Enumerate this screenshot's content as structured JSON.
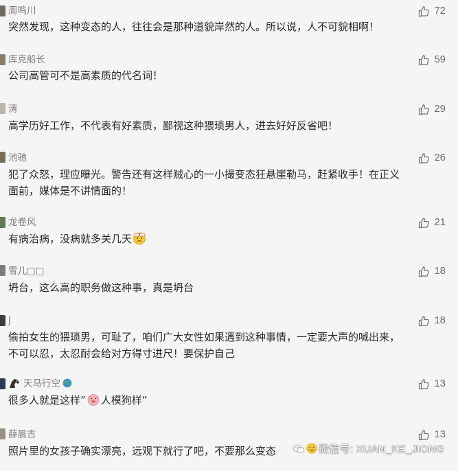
{
  "comments": [
    {
      "nick": "周鸣川",
      "likes": "72",
      "text": "突然发现，这种变态的人，往往会是那种道貌岸然的人。所以说，人不可貌相啊！"
    },
    {
      "nick": "库克船长",
      "likes": "59",
      "text": "公司高管可不是高素质的代名词！"
    },
    {
      "nick": "清",
      "likes": "29",
      "text": "高学历好工作，不代表有好素质，鄙视这种猥琐男人，进去好好反省吧！"
    },
    {
      "nick": "池驰",
      "likes": "26",
      "text_line1": "犯了众怒，理应曝光。警告还有这样贼心的一小撮变态狂悬崖勒马，赶紧收手！在正义",
      "text_line2": "面前，媒体是不讲情面的！"
    },
    {
      "nick": "龙卷风",
      "likes": "21",
      "text": "有病治病，没病就多关几天"
    },
    {
      "nick": "雪儿□□",
      "likes": "18",
      "text": "坍台，这么高的职务做这种事，真是坍台"
    },
    {
      "nick": "J",
      "likes": "18",
      "text_line1": "偷拍女生的猥琐男，可耻了，咱们广大女性如果遇到这种事情，一定要大声的喊出来，",
      "text_line2": "不可以忍，太忍耐会给对方得寸进尺！要保护自己"
    },
    {
      "nick": "天马行空",
      "likes": "13",
      "text_a": "很多人就是这样”",
      "text_b": "人模狗样”"
    },
    {
      "nick": "薛晨吉",
      "likes": "13",
      "text": "照片里的女孩子确实漂亮，远观下就行了吧，不要那么变态"
    }
  ],
  "watermark": "微信号: XUAN_KE_JIONG",
  "icons": {
    "like": "thumbs-up-icon"
  },
  "colors": {
    "nick": "#7d7d7d",
    "text": "#2b2b2b",
    "background": "#f5f5f5"
  }
}
